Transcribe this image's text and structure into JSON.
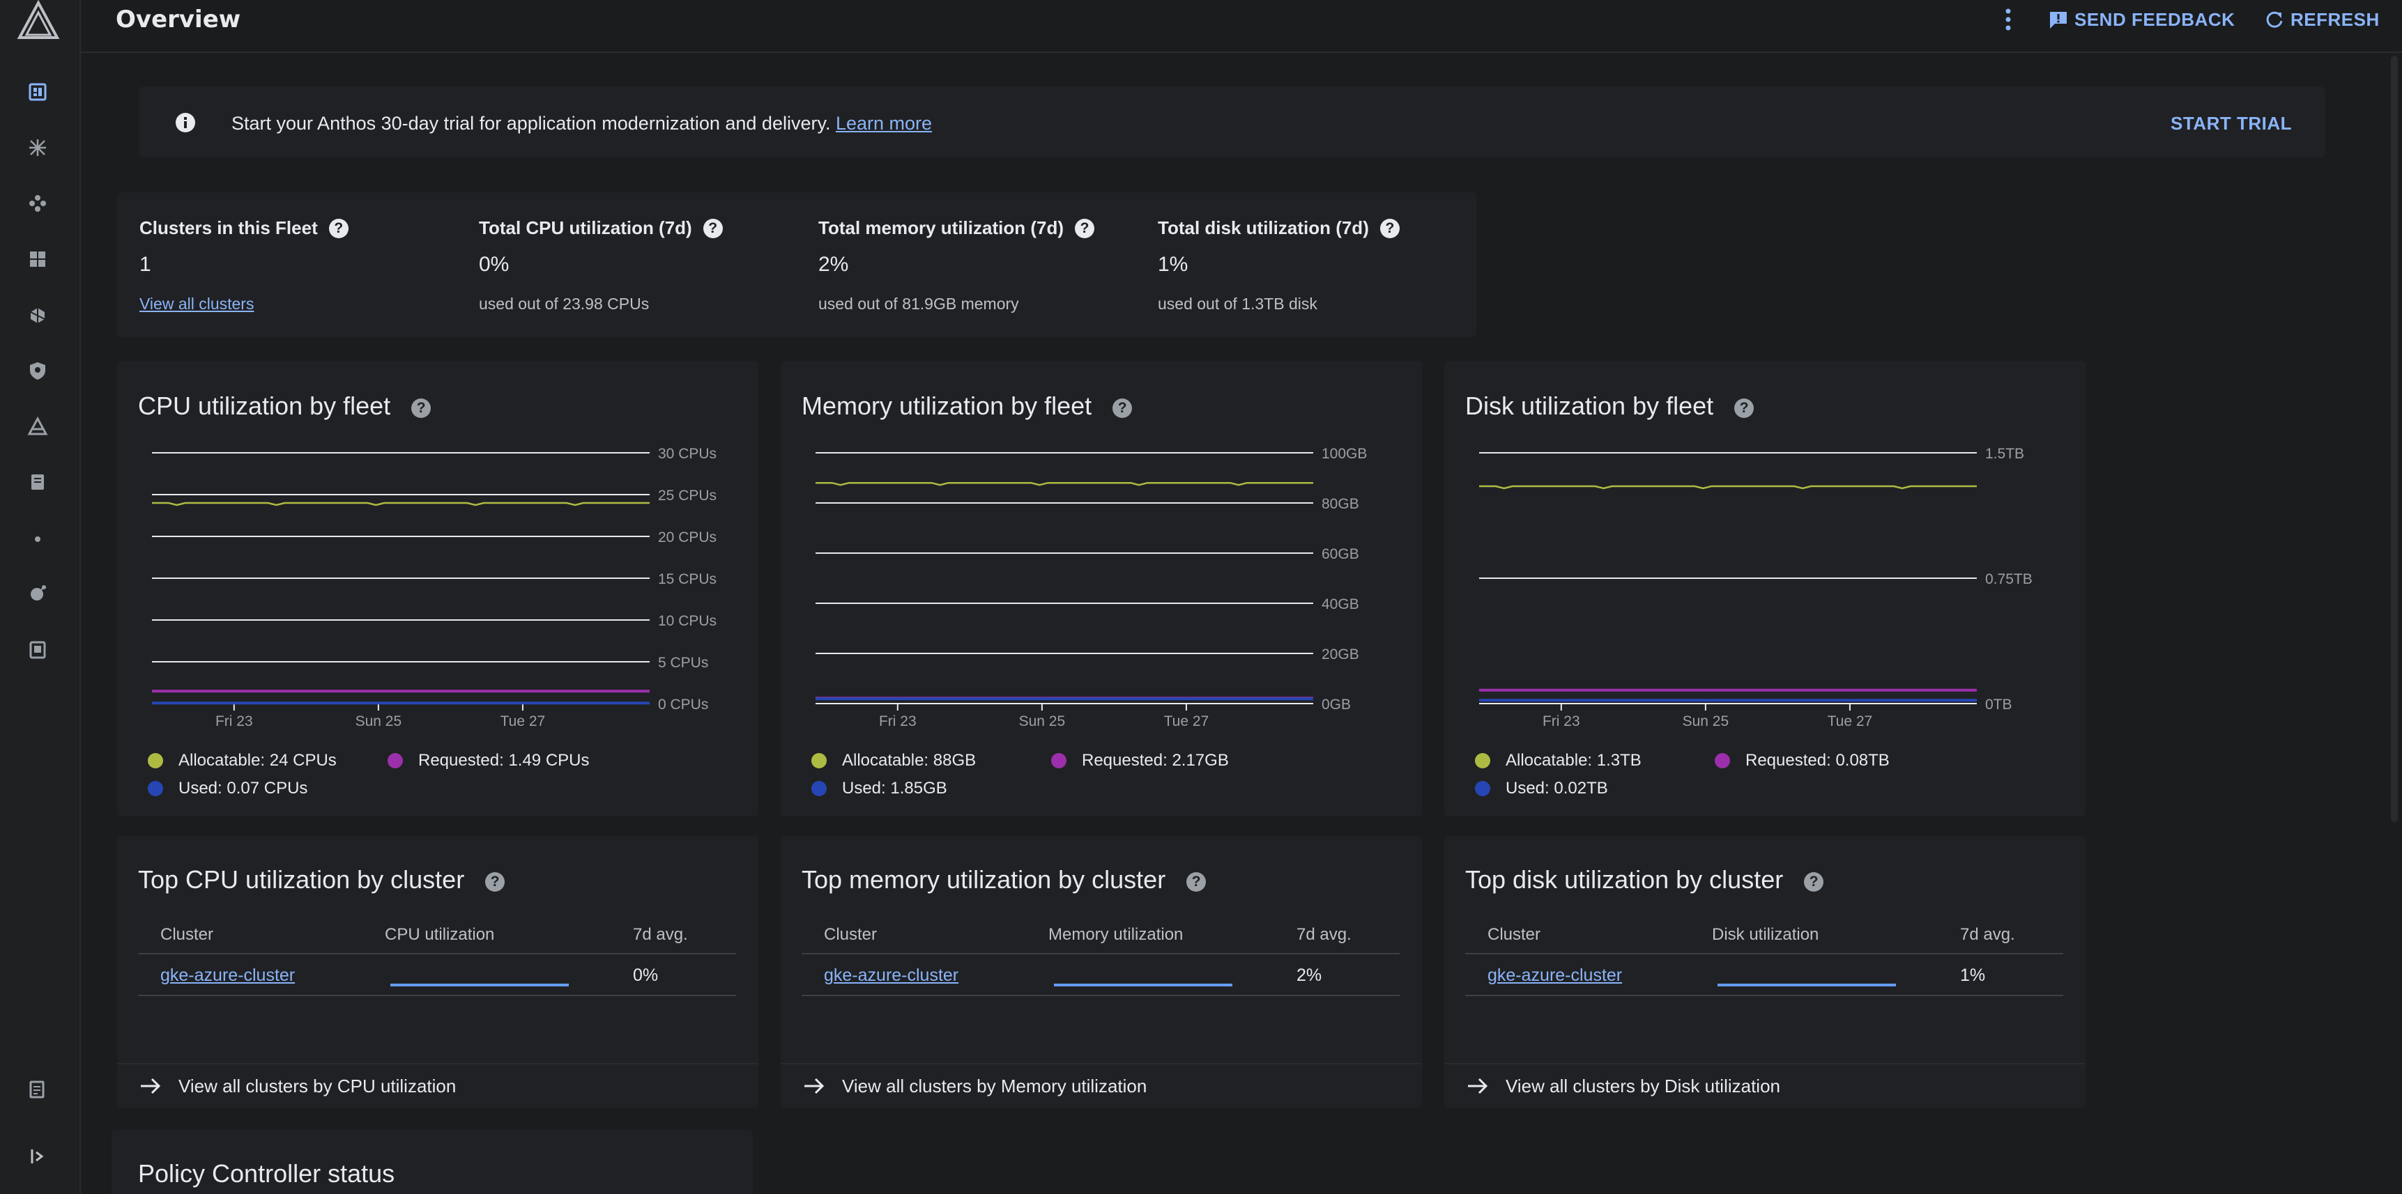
{
  "header": {
    "title": "Overview",
    "feedback_label": "SEND FEEDBACK",
    "refresh_label": "REFRESH"
  },
  "banner": {
    "text": "Start your Anthos 30-day trial for application modernization and delivery.",
    "link": "Learn more",
    "action": "START TRIAL"
  },
  "summary": {
    "clusters": {
      "label": "Clusters in this Fleet",
      "value": "1",
      "link": "View all clusters"
    },
    "cpu": {
      "label": "Total CPU utilization (7d)",
      "value": "0%",
      "sub": "used out of 23.98 CPUs"
    },
    "memory": {
      "label": "Total memory utilization (7d)",
      "value": "2%",
      "sub": "used out of 81.9GB memory"
    },
    "disk": {
      "label": "Total disk utilization (7d)",
      "value": "1%",
      "sub": "used out of 1.3TB disk"
    }
  },
  "colors": {
    "allocatable": "#aebb42",
    "requested": "#9c2fab",
    "used": "#2546b4",
    "link": "#8ab4f8"
  },
  "chart_data": [
    {
      "type": "line",
      "title": "CPU utilization by fleet",
      "x_ticks": [
        "Fri 23",
        "Sun 25",
        "Tue 27"
      ],
      "y_ticks": [
        "0 CPUs",
        "5 CPUs",
        "10 CPUs",
        "15 CPUs",
        "20 CPUs",
        "25 CPUs",
        "30 CPUs"
      ],
      "ylim": [
        0,
        30
      ],
      "series": [
        {
          "name": "Allocatable",
          "key": "allocatable",
          "value": 24
        },
        {
          "name": "Requested",
          "key": "requested",
          "value": 1.49
        },
        {
          "name": "Used",
          "key": "used",
          "value": 0.07
        }
      ],
      "legend": {
        "allocatable": "24 CPUs",
        "requested": "1.49 CPUs",
        "used": "0.07 CPUs"
      }
    },
    {
      "type": "line",
      "title": "Memory utilization by fleet",
      "x_ticks": [
        "Fri 23",
        "Sun 25",
        "Tue 27"
      ],
      "y_ticks": [
        "0GB",
        "20GB",
        "40GB",
        "60GB",
        "80GB",
        "100GB"
      ],
      "ylim": [
        0,
        100
      ],
      "series": [
        {
          "name": "Allocatable",
          "key": "allocatable",
          "value": 88
        },
        {
          "name": "Requested",
          "key": "requested",
          "value": 2.17
        },
        {
          "name": "Used",
          "key": "used",
          "value": 1.85
        }
      ],
      "legend": {
        "allocatable": "88GB",
        "requested": "2.17GB",
        "used": "1.85GB"
      }
    },
    {
      "type": "line",
      "title": "Disk utilization by fleet",
      "x_ticks": [
        "Fri 23",
        "Sun 25",
        "Tue 27"
      ],
      "y_ticks": [
        "0TB",
        "0.75TB",
        "1.5TB"
      ],
      "ylim": [
        0,
        1.5
      ],
      "series": [
        {
          "name": "Allocatable",
          "key": "allocatable",
          "value": 1.3
        },
        {
          "name": "Requested",
          "key": "requested",
          "value": 0.08
        },
        {
          "name": "Used",
          "key": "used",
          "value": 0.02
        }
      ],
      "legend": {
        "allocatable": "1.3TB",
        "requested": "0.08TB",
        "used": "0.02TB"
      }
    }
  ],
  "legend_labels": {
    "allocatable": "Allocatable:",
    "requested": "Requested:",
    "used": "Used:"
  },
  "tables": [
    {
      "title": "Top CPU utilization by cluster",
      "columns": [
        "Cluster",
        "CPU utilization",
        "7d avg."
      ],
      "row": {
        "cluster": "gke-azure-cluster",
        "fraction": 0.0,
        "avg": "0%"
      },
      "footer": "View all clusters by CPU utilization"
    },
    {
      "title": "Top memory utilization by cluster",
      "columns": [
        "Cluster",
        "Memory utilization",
        "7d avg."
      ],
      "row": {
        "cluster": "gke-azure-cluster",
        "fraction": 0.02,
        "avg": "2%"
      },
      "footer": "View all clusters by Memory utilization"
    },
    {
      "title": "Top disk utilization by cluster",
      "columns": [
        "Cluster",
        "Disk utilization",
        "7d avg."
      ],
      "row": {
        "cluster": "gke-azure-cluster",
        "fraction": 0.01,
        "avg": "1%"
      },
      "footer": "View all clusters by Disk utilization"
    }
  ],
  "policy": {
    "title": "Policy Controller status"
  },
  "nav": {
    "icons": [
      "dashboard-icon",
      "clusters-icon",
      "workloads-icon",
      "apps-icon",
      "config-icon",
      "security-icon",
      "anthos-icon",
      "features-icon",
      "dot-icon",
      "service-mesh-icon",
      "backup-icon",
      "release-notes-icon",
      "expand-rail-icon"
    ]
  }
}
